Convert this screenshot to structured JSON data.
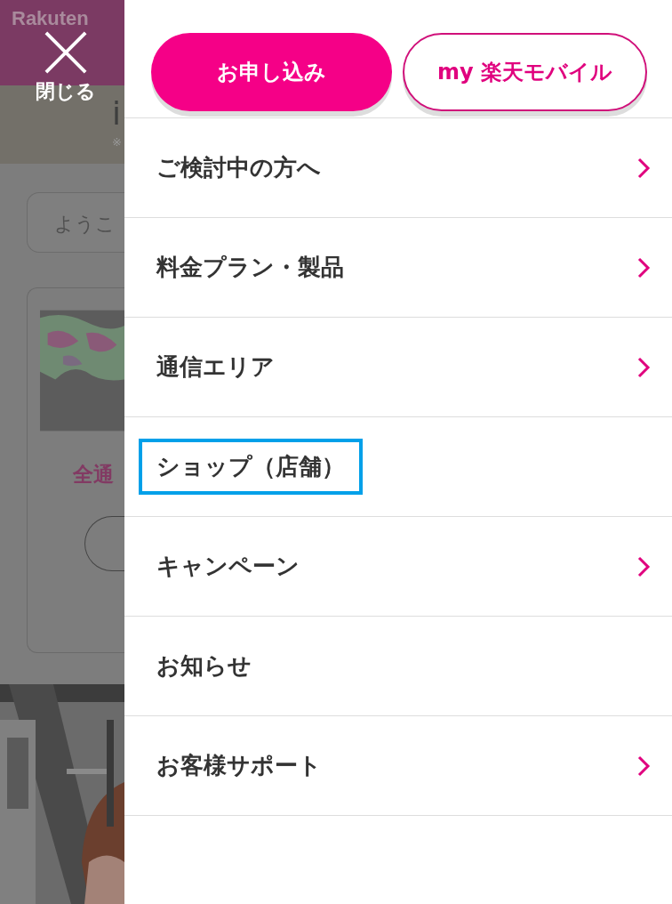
{
  "background_page": {
    "logo": [
      "Rakuten"
    ],
    "fragments": [
      "i",
      "※"
    ],
    "search_placeholder": "ようこ",
    "card_title": "全通",
    "kind": "picture"
  },
  "close_button": {
    "label": "閉じる"
  },
  "buttons": [
    {
      "label": "お申し込み",
      "kind": "filled"
    },
    {
      "label": "my 楽天モバイル",
      "kind": "outline"
    }
  ],
  "menu": {
    "items": [
      {
        "label": "ご検討中の方へ",
        "has_chevron": true,
        "highlighted": false
      },
      {
        "label": "料金プラン・製品",
        "has_chevron": true,
        "highlighted": false
      },
      {
        "label": "通信エリア",
        "has_chevron": true,
        "highlighted": false
      },
      {
        "label": "ショップ（店舗）",
        "has_chevron": false,
        "highlighted": true
      },
      {
        "label": "キャンペーン",
        "has_chevron": true,
        "highlighted": false
      },
      {
        "label": "お知らせ",
        "has_chevron": false,
        "highlighted": false
      },
      {
        "label": "お客様サポート",
        "has_chevron": true,
        "highlighted": false
      }
    ]
  }
}
